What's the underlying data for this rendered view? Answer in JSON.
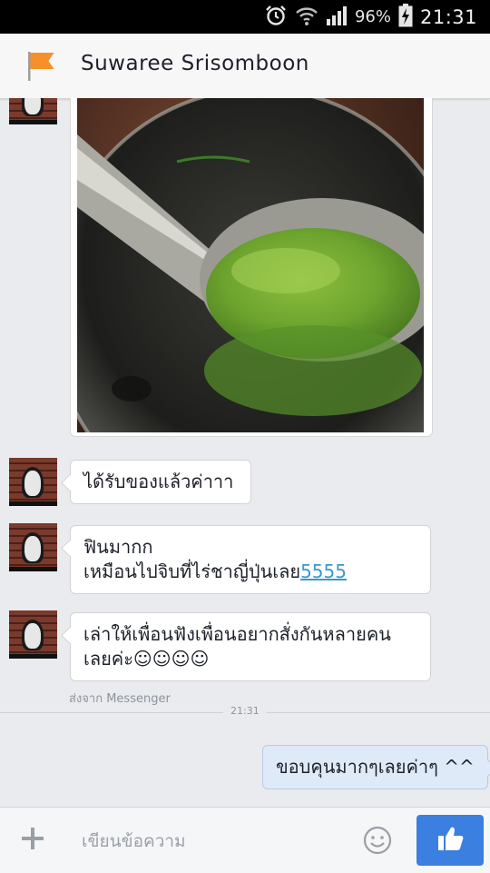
{
  "status_bar": {
    "battery_percent": "96%",
    "time": "21:31"
  },
  "header": {
    "title": "Suwaree Srisomboon"
  },
  "messages": [
    {
      "text": "ได้รับของแล้วค่าาา"
    },
    {
      "line1": "ฟินมากก",
      "line2_prefix": "เหมือนไปจิบที่ไร่ชาญี่ปุ่นเลย",
      "line2_link": "5555"
    },
    {
      "line1": "เล่าให้เพื่อนฟังเพื่อนอยากสั่งกันหลายคน",
      "line2": "เลยค่ะ☺☺☺☺"
    }
  ],
  "sent_via": "ส่งจาก Messenger",
  "divider_time": "21:31",
  "sent_message": "ขอบคุนมากๆเลยค่าๆ ^^",
  "composer": {
    "placeholder": "เขียนข้อความ"
  },
  "colors": {
    "accent": "#3b7fe0",
    "link": "#3b9ac9",
    "flag": "#f5902a"
  }
}
